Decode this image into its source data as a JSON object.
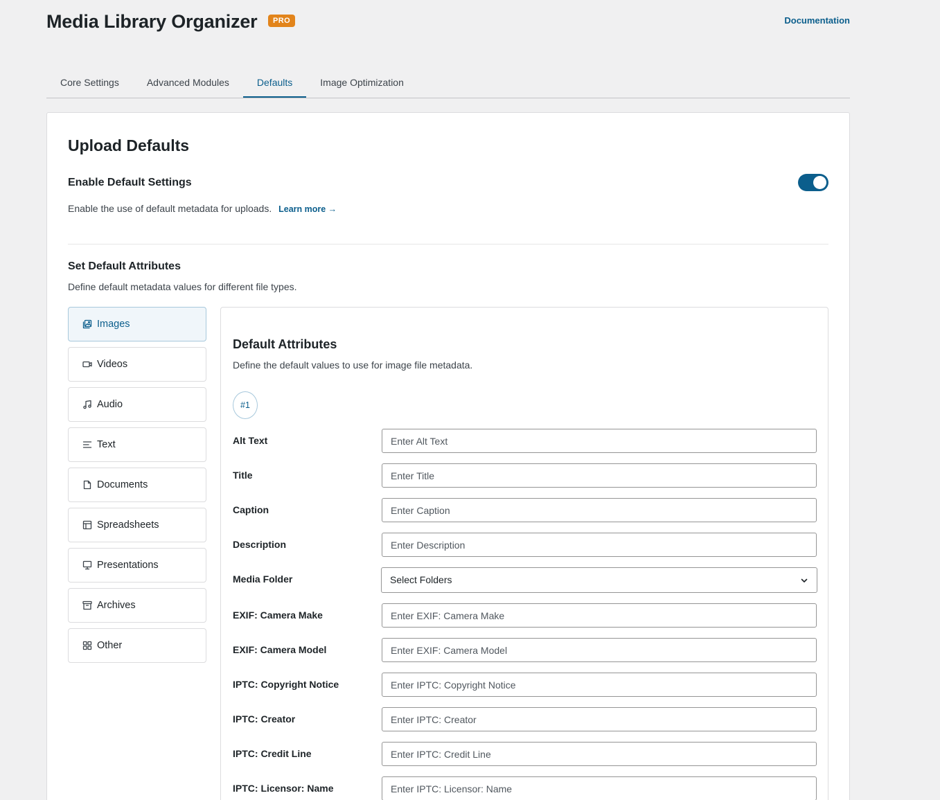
{
  "header": {
    "title": "Media Library Organizer",
    "badge": "PRO",
    "doc_link": "Documentation"
  },
  "tabs": [
    {
      "label": "Core Settings",
      "active": false
    },
    {
      "label": "Advanced Modules",
      "active": false
    },
    {
      "label": "Defaults",
      "active": true
    },
    {
      "label": "Image Optimization",
      "active": false
    }
  ],
  "panel": {
    "title": "Upload Defaults",
    "enable": {
      "title": "Enable Default Settings",
      "description": "Enable the use of default metadata for uploads.",
      "learn_more": "Learn more →",
      "enabled": true
    },
    "attributes": {
      "title": "Set Default Attributes",
      "description": "Define default metadata values for different file types."
    }
  },
  "file_types": [
    {
      "label": "Images",
      "icon": "images-icon",
      "active": true
    },
    {
      "label": "Videos",
      "icon": "video-icon",
      "active": false
    },
    {
      "label": "Audio",
      "icon": "music-icon",
      "active": false
    },
    {
      "label": "Text",
      "icon": "text-lines-icon",
      "active": false
    },
    {
      "label": "Documents",
      "icon": "document-icon",
      "active": false
    },
    {
      "label": "Spreadsheets",
      "icon": "table-icon",
      "active": false
    },
    {
      "label": "Presentations",
      "icon": "presentation-icon",
      "active": false
    },
    {
      "label": "Archives",
      "icon": "archive-icon",
      "active": false
    },
    {
      "label": "Other",
      "icon": "grid-icon",
      "active": false
    }
  ],
  "detail": {
    "title": "Default Attributes",
    "description": "Define the default values to use for image file metadata.",
    "rule_badge": "#1",
    "fields": [
      {
        "label": "Alt Text",
        "placeholder": "Enter Alt Text",
        "value": ""
      },
      {
        "label": "Title",
        "placeholder": "Enter Title",
        "value": ""
      },
      {
        "label": "Caption",
        "placeholder": "Enter Caption",
        "value": ""
      },
      {
        "label": "Description",
        "placeholder": "Enter Description",
        "value": ""
      },
      {
        "label": "Media Folder",
        "type": "select",
        "selected": "Select Folders"
      },
      {
        "label": "EXIF: Camera Make",
        "placeholder": "Enter EXIF: Camera Make",
        "value": ""
      },
      {
        "label": "EXIF: Camera Model",
        "placeholder": "Enter EXIF: Camera Model",
        "value": ""
      },
      {
        "label": "IPTC: Copyright Notice",
        "placeholder": "Enter IPTC: Copyright Notice",
        "value": ""
      },
      {
        "label": "IPTC: Creator",
        "placeholder": "Enter IPTC: Creator",
        "value": ""
      },
      {
        "label": "IPTC: Credit Line",
        "placeholder": "Enter IPTC: Credit Line",
        "value": ""
      },
      {
        "label": "IPTC: Licensor: Name",
        "placeholder": "Enter IPTC: Licensor: Name",
        "value": ""
      }
    ]
  },
  "colors": {
    "accent": "#0b5e8c",
    "badge": "#e2841b",
    "background": "#f0f0f1"
  }
}
